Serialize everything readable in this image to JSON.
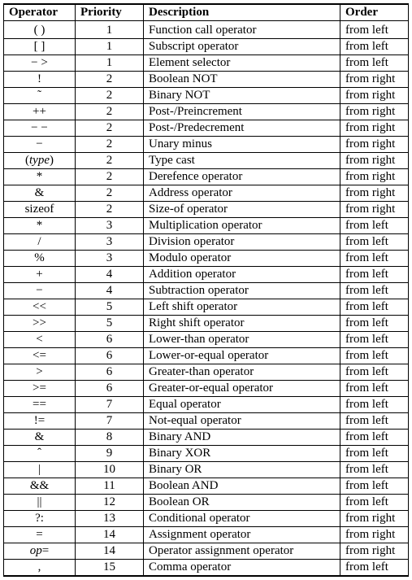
{
  "headers": {
    "operator": "Operator",
    "priority": "Priority",
    "description": "Description",
    "order": "Order"
  },
  "rows": [
    {
      "op": "( )",
      "op_html": "( )",
      "pri": "1",
      "desc": "Function call operator",
      "ord": "from left"
    },
    {
      "op": "[ ]",
      "op_html": "[ ]",
      "pri": "1",
      "desc": "Subscript operator",
      "ord": "from left"
    },
    {
      "op": "->",
      "op_html": "&minus; &gt;",
      "pri": "1",
      "desc": "Element selector",
      "ord": "from left"
    },
    {
      "op": "!",
      "op_html": "!",
      "pri": "2",
      "desc": "Boolean NOT",
      "ord": "from right"
    },
    {
      "op": "~",
      "op_html": "&#732;",
      "pri": "2",
      "desc": "Binary NOT",
      "ord": "from right"
    },
    {
      "op": "++",
      "op_html": "++",
      "pri": "2",
      "desc": "Post-/Preincrement",
      "ord": "from right"
    },
    {
      "op": "--",
      "op_html": "&minus; &minus;",
      "pri": "2",
      "desc": "Post-/Predecrement",
      "ord": "from right"
    },
    {
      "op": "-",
      "op_html": "&minus;",
      "pri": "2",
      "desc": "Unary minus",
      "ord": "from right"
    },
    {
      "op": "(type)",
      "op_html": "(<span class=\"ital\">type</span>)",
      "pri": "2",
      "desc": "Type cast",
      "ord": "from right"
    },
    {
      "op": "*",
      "op_html": "*",
      "pri": "2",
      "desc": "Derefence operator",
      "ord": "from right"
    },
    {
      "op": "&",
      "op_html": "&amp;",
      "pri": "2",
      "desc": "Address operator",
      "ord": "from right"
    },
    {
      "op": "sizeof",
      "op_html": "sizeof",
      "pri": "2",
      "desc": "Size-of operator",
      "ord": "from right"
    },
    {
      "op": "*",
      "op_html": "*",
      "pri": "3",
      "desc": "Multiplication operator",
      "ord": "from left"
    },
    {
      "op": "/",
      "op_html": "/",
      "pri": "3",
      "desc": "Division operator",
      "ord": "from left"
    },
    {
      "op": "%",
      "op_html": "%",
      "pri": "3",
      "desc": "Modulo operator",
      "ord": "from left"
    },
    {
      "op": "+",
      "op_html": "+",
      "pri": "4",
      "desc": "Addition operator",
      "ord": "from left"
    },
    {
      "op": "-",
      "op_html": "&minus;",
      "pri": "4",
      "desc": "Subtraction operator",
      "ord": "from left"
    },
    {
      "op": "<<",
      "op_html": "&lt;&lt;",
      "pri": "5",
      "desc": "Left shift operator",
      "ord": "from left"
    },
    {
      "op": ">>",
      "op_html": "&gt;&gt;",
      "pri": "5",
      "desc": "Right shift operator",
      "ord": "from left"
    },
    {
      "op": "<",
      "op_html": "&lt;",
      "pri": "6",
      "desc": "Lower-than operator",
      "ord": "from left"
    },
    {
      "op": "<=",
      "op_html": "&lt;=",
      "pri": "6",
      "desc": "Lower-or-equal operator",
      "ord": "from left"
    },
    {
      "op": ">",
      "op_html": "&gt;",
      "pri": "6",
      "desc": "Greater-than operator",
      "ord": "from left"
    },
    {
      "op": ">=",
      "op_html": "&gt;=",
      "pri": "6",
      "desc": "Greater-or-equal operator",
      "ord": "from left"
    },
    {
      "op": "==",
      "op_html": "==",
      "pri": "7",
      "desc": "Equal operator",
      "ord": "from left"
    },
    {
      "op": "!=",
      "op_html": "!=",
      "pri": "7",
      "desc": "Not-equal operator",
      "ord": "from left"
    },
    {
      "op": "&",
      "op_html": "&amp;",
      "pri": "8",
      "desc": "Binary AND",
      "ord": "from left"
    },
    {
      "op": "^",
      "op_html": "&#710;",
      "pri": "9",
      "desc": "Binary XOR",
      "ord": "from left"
    },
    {
      "op": "|",
      "op_html": "|",
      "pri": "10",
      "desc": "Binary OR",
      "ord": "from left"
    },
    {
      "op": "&&",
      "op_html": "&amp;&amp;",
      "pri": "11",
      "desc": "Boolean AND",
      "ord": "from left"
    },
    {
      "op": "||",
      "op_html": "||",
      "pri": "12",
      "desc": "Boolean OR",
      "ord": "from left"
    },
    {
      "op": "?:",
      "op_html": "?:",
      "pri": "13",
      "desc": "Conditional operator",
      "ord": "from right"
    },
    {
      "op": "=",
      "op_html": "=",
      "pri": "14",
      "desc": "Assignment operator",
      "ord": "from right"
    },
    {
      "op": "op=",
      "op_html": "<span class=\"ital\">op</span>=",
      "pri": "14",
      "desc": "Operator assignment operator",
      "ord": "from right"
    },
    {
      "op": ",",
      "op_html": ",",
      "pri": "15",
      "desc": "Comma operator",
      "ord": "from left"
    }
  ]
}
